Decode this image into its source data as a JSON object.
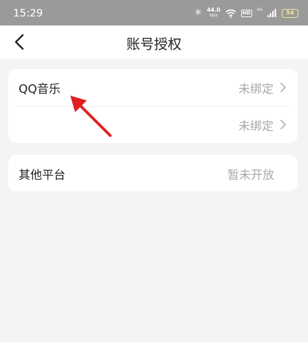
{
  "status_bar": {
    "time": "15:29",
    "net_speed": "44.0",
    "net_speed_unit": "KB/S",
    "hd_badge": "HD",
    "network_tag": "4G",
    "battery": "54",
    "icons": [
      "bluetooth-icon",
      "wifi-icon",
      "signal-icon",
      "battery-icon"
    ]
  },
  "nav": {
    "title": "账号授权",
    "back_icon": "chevron-left-icon"
  },
  "accounts": [
    {
      "label": "QQ音乐",
      "status": "未绑定"
    },
    {
      "label": "",
      "status": "未绑定"
    }
  ],
  "other_platform": {
    "label": "其他平台",
    "status": "暂未开放"
  },
  "annotation": {
    "type": "arrow",
    "color": "#e02020"
  }
}
